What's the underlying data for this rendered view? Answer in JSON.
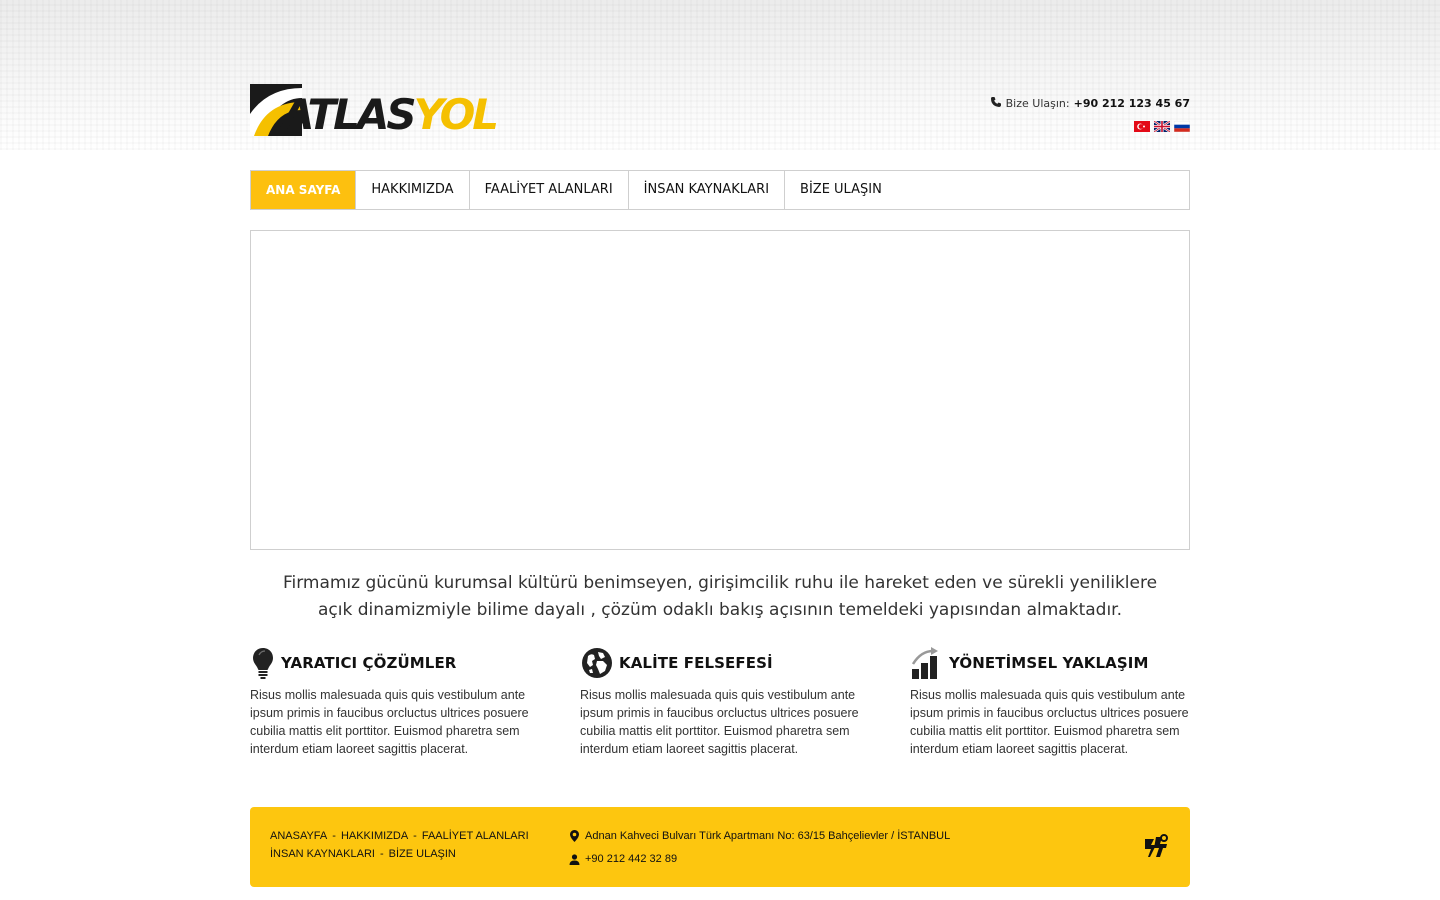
{
  "brand": {
    "logo_part1": "ATLAS",
    "logo_part2": "YOL",
    "colors": {
      "accent": "#fdc00f",
      "dark": "#1a1a1a"
    }
  },
  "header": {
    "contact_label": "Bize Ulaşın:",
    "contact_phone": "+90 212 123 45 67",
    "phone_icon": "phone-icon",
    "languages": [
      "tr-flag-icon",
      "uk-flag-icon",
      "ru-flag-icon"
    ]
  },
  "nav": {
    "items": [
      {
        "label": "ANA SAYFA",
        "active": true
      },
      {
        "label": "HAKKIMIZDA",
        "active": false
      },
      {
        "label": "FAALİYET ALANLARI",
        "active": false
      },
      {
        "label": "İNSAN KAYNAKLARI",
        "active": false
      },
      {
        "label": "BİZE ULAŞIN",
        "active": false
      }
    ]
  },
  "intro": {
    "text": "Firmamız gücünü kurumsal kültürü benimseyen, girişimcilik ruhu ile hareket eden ve sürekli yeniliklere açık dinamizmiyle bilime dayalı , çözüm odaklı bakış açısının temeldeki yapısından almaktadır."
  },
  "features": [
    {
      "icon": "lightbulb-icon",
      "title": "YARATICI ÇÖZÜMLER",
      "body": "Risus mollis malesuada quis quis vestibulum ante ipsum primis in faucibus orcluctus ultrices posuere cubilia mattis elit porttitor. Euismod pharetra sem interdum etiam laoreet sagittis placerat."
    },
    {
      "icon": "globe-icon",
      "title": "KALİTE FELSEFESİ",
      "body": "Risus mollis malesuada quis quis vestibulum ante ipsum primis in faucibus orcluctus ultrices posuere cubilia mattis elit porttitor. Euismod pharetra sem interdum etiam laoreet sagittis placerat."
    },
    {
      "icon": "bar-chart-icon",
      "title": "YÖNETİMSEL YAKLAŞIM",
      "body": "Risus mollis malesuada quis quis vestibulum ante ipsum primis in faucibus orcluctus ultrices posuere cubilia mattis elit porttitor. Euismod pharetra sem interdum etiam laoreet sagittis placerat."
    }
  ],
  "footer": {
    "links_row1": [
      "ANASAYFA",
      "HAKKIMIZDA",
      "FAALİYET ALANLARI"
    ],
    "links_row2": [
      "İNSAN KAYNAKLARI",
      "BİZE ULAŞIN"
    ],
    "separator": "-",
    "address": "Adnan Kahveci Bulvarı Türk Apartmanı No: 63/15 Bahçelievler / İSTANBUL",
    "phone": "+90 212 442 32 89",
    "address_icon": "map-pin-icon",
    "phone_icon": "contact-icon",
    "agency_icon": "agency-logo-icon"
  }
}
